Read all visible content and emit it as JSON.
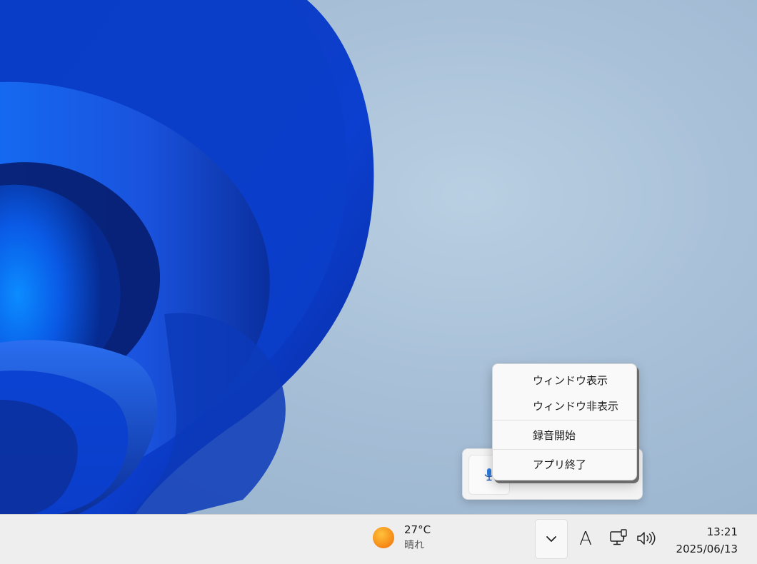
{
  "context_menu": {
    "items": [
      {
        "label": "ウィンドウ表示"
      },
      {
        "label": "ウィンドウ非表示"
      },
      {
        "label": "録音開始"
      },
      {
        "label": "アプリ終了"
      }
    ]
  },
  "tray_flyout": {
    "app_icon": "microphone-icon"
  },
  "taskbar": {
    "weather": {
      "temperature": "27°C",
      "condition": "晴れ",
      "icon": "sun-icon"
    },
    "overflow_icon": "chevron-up-icon",
    "ime_mode": "A",
    "network_icon": "network-icon",
    "volume_icon": "volume-icon",
    "clock": {
      "time": "13:21",
      "date": "2025/06/13"
    }
  },
  "colors": {
    "wallpaper_accent": "#1a4fd6",
    "desktop_bg": "#a9c0d6",
    "taskbar_bg": "#eeeeee"
  }
}
